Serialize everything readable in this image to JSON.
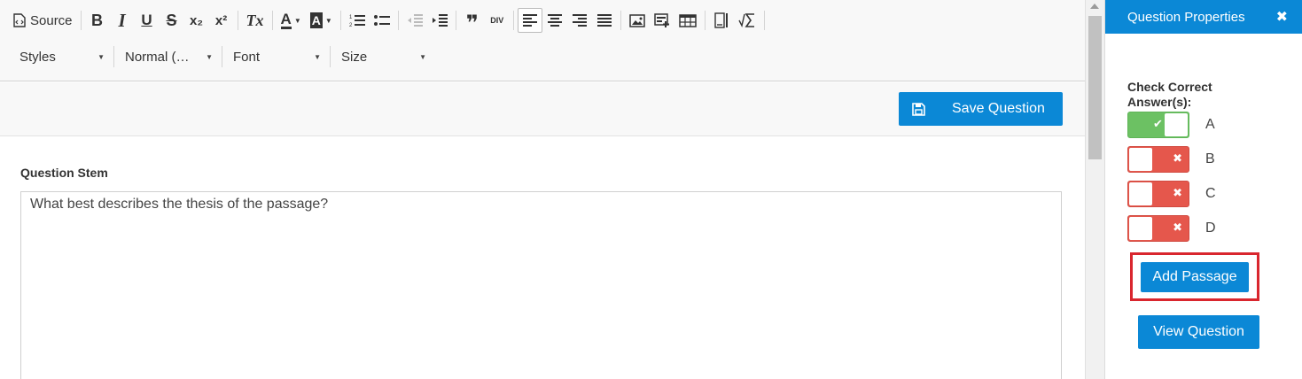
{
  "toolbar": {
    "source_label": "Source",
    "icons": {
      "source": "source-icon",
      "bold": "B",
      "italic": "I",
      "underline": "U",
      "strike": "S",
      "subscript": "x₂",
      "superscript": "x²",
      "remove_format": "Tx",
      "text_color": "A",
      "bg_color": "A",
      "blockquote": "❞",
      "div": "DIV"
    },
    "combos": {
      "styles": "Styles",
      "format": "Normal (…",
      "font": "Font",
      "size": "Size"
    }
  },
  "save": {
    "label": "Save Question"
  },
  "stem": {
    "label": "Question Stem",
    "value": "What best describes the thesis of the passage?"
  },
  "panel": {
    "title": "Question Properties",
    "close": "✖",
    "check_label": "Check Correct Answer(s):",
    "answers": [
      {
        "letter": "A",
        "correct": true,
        "mark": "✔"
      },
      {
        "letter": "B",
        "correct": false,
        "mark": "✖"
      },
      {
        "letter": "C",
        "correct": false,
        "mark": "✖"
      },
      {
        "letter": "D",
        "correct": false,
        "mark": "✖"
      }
    ],
    "add_passage": "Add Passage",
    "view_question": "View Question"
  },
  "colors": {
    "accent": "#0b88d6",
    "toggle_on": "#6cc163",
    "toggle_off": "#e5574c",
    "highlight": "#d9262e"
  }
}
